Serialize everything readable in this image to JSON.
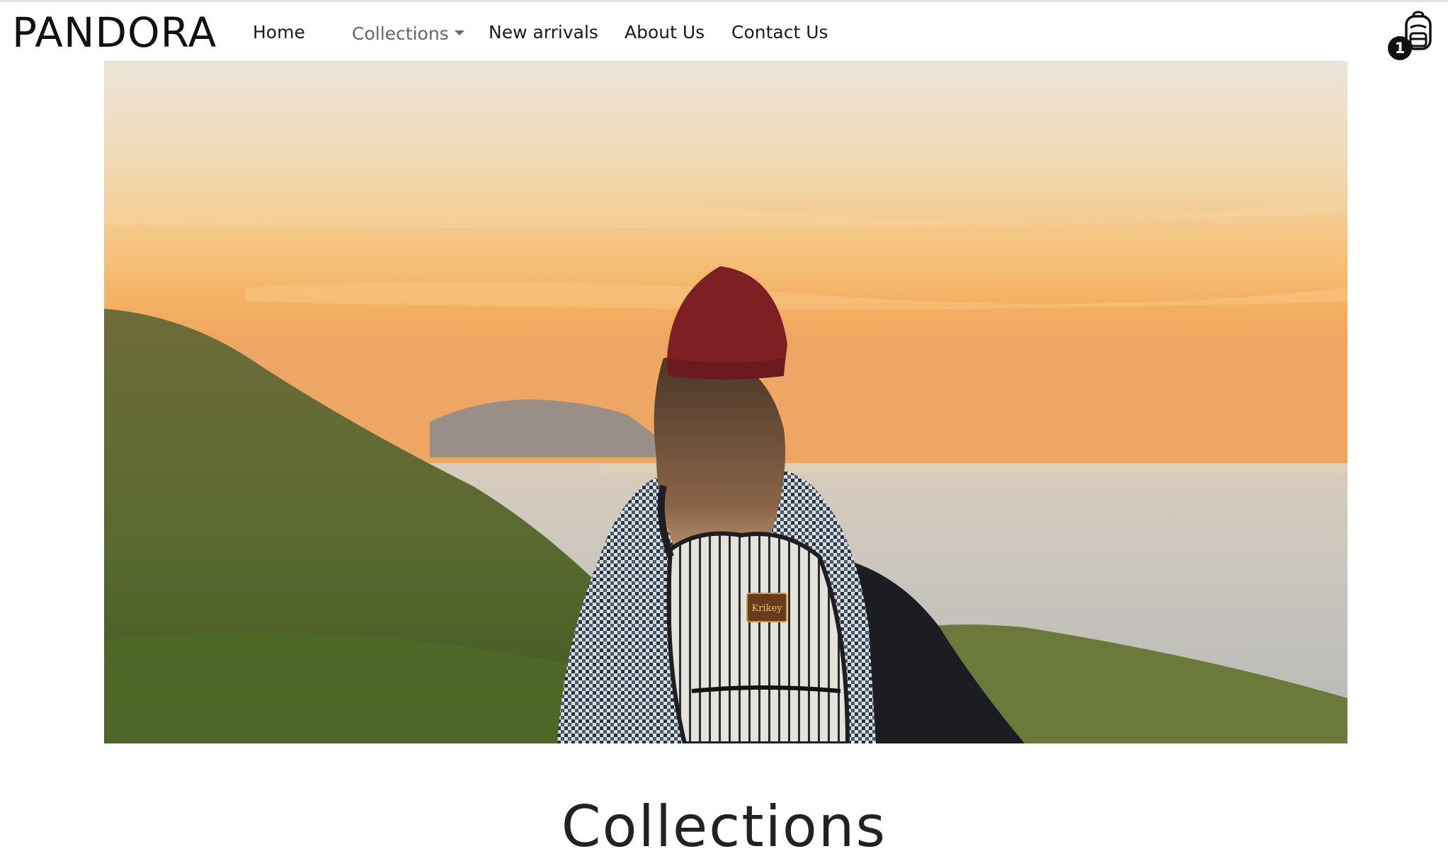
{
  "brand": "PANDORA",
  "nav": {
    "home": "Home",
    "collections": "Collections",
    "new_arrivals": "New arrivals",
    "about": "About Us",
    "contact": "Contact Us"
  },
  "cart": {
    "count": "1",
    "icon": "backpack-icon"
  },
  "hero": {
    "alt": "hiker with striped backpack overlooking sea at sunset",
    "patch_text": "Krikey"
  },
  "section": {
    "title": "Collections"
  },
  "colors": {
    "sky_top": "#ece4d6",
    "sky_glow": "#f4b567",
    "sea": "#c9c2b7",
    "hill": "#5f6a34",
    "beanie": "#7d1f24"
  }
}
